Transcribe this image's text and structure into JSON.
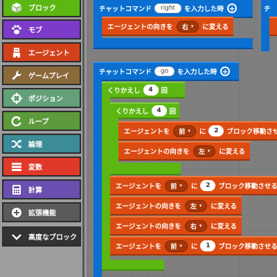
{
  "categories": [
    {
      "name": "cat-blocks",
      "label": "ブロック",
      "icon": "block-icon",
      "color": "#5cb712"
    },
    {
      "name": "cat-mobs",
      "label": "モブ",
      "icon": "paw-icon",
      "color": "#7c3bc9"
    },
    {
      "name": "cat-agent",
      "label": "エージェント",
      "icon": "agent-icon",
      "color": "#d3411b"
    },
    {
      "name": "cat-gameplay",
      "label": "ゲームプレイ",
      "icon": "wrench-icon",
      "color": "#8a6a3a"
    },
    {
      "name": "cat-position",
      "label": "ポジション",
      "icon": "crosshair-icon",
      "color": "#63a079"
    },
    {
      "name": "cat-loops",
      "label": "ループ",
      "icon": "loop-arrow-icon",
      "color": "#5c9a3c"
    },
    {
      "name": "cat-logic",
      "label": "論理",
      "icon": "shuffle-icon",
      "color": "#3b8c96"
    },
    {
      "name": "cat-variables",
      "label": "変数",
      "icon": "list-icon",
      "color": "#e0392a"
    },
    {
      "name": "cat-math",
      "label": "計算",
      "icon": "calculator-icon",
      "color": "#6a4fb0"
    },
    {
      "name": "cat-extensions",
      "label": "拡張機能",
      "icon": "plus-circle-icon",
      "color": "#5a5a5a"
    },
    {
      "name": "cat-advanced",
      "label": "高度なブロック",
      "icon": "chevron-down-icon",
      "color": "#333333"
    }
  ],
  "workspace": {
    "event1": {
      "prefix": "チャットコマンド",
      "command": "right",
      "suffix": "を入力した時",
      "plus": "+"
    },
    "event1_body": {
      "text_left": "エージェントの向きを",
      "dir": "右",
      "caret": "▾",
      "text_right": "に変える"
    },
    "event2": {
      "prefix": "チャットコマンド",
      "command": "go",
      "suffix": "を入力した時",
      "plus": "+"
    },
    "loop_outer": {
      "label": "くりかえし",
      "count": "4",
      "unit": "回"
    },
    "loop_inner": {
      "label": "くりかえし",
      "count": "4",
      "unit": "回"
    },
    "inner_actions": [
      {
        "text_left": "エージェントを",
        "dir": "前",
        "mid": "に",
        "count": "2",
        "text_right": "ブロック移動させる"
      },
      {
        "text_left": "エージェントの向きを",
        "dir": "左",
        "text_right": "に変える"
      }
    ],
    "outer_actions": [
      {
        "text_left": "エージェントを",
        "dir": "前",
        "mid": "に",
        "count": "2",
        "text_right": "ブロック移動させる"
      },
      {
        "text_left": "エージェントの向きを",
        "dir": "左",
        "text_right": "に変える"
      },
      {
        "text_left": "エージェントの向きを",
        "dir": "右",
        "text_right": "に変える"
      },
      {
        "text_left": "エージェントを",
        "dir": "前",
        "mid": "に",
        "count": "1",
        "text_right": "ブロック移動させる"
      }
    ],
    "clipped_event_letter": "チ",
    "caret": "▾"
  }
}
